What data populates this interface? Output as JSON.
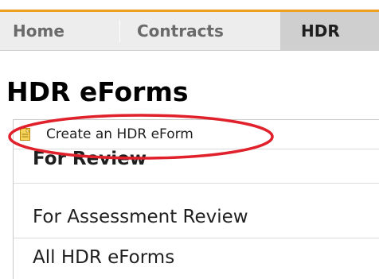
{
  "tabs": {
    "home_label": "Home",
    "contracts_label": "Contracts",
    "hdr_label": "HDR",
    "active": "HDR"
  },
  "page": {
    "title": "HDR eForms"
  },
  "menu": {
    "create_label": "Create an HDR eForm",
    "for_review_label": "For Review",
    "assessment_label": "For Assessment Review",
    "all_label": "All HDR eForms"
  },
  "icons": {
    "create_icon": "document-icon"
  },
  "colors": {
    "accent": "#f0a020",
    "annotation": "#e0202a",
    "tab_active_bg": "#cfcfcf",
    "tab_bg": "#ededed"
  }
}
